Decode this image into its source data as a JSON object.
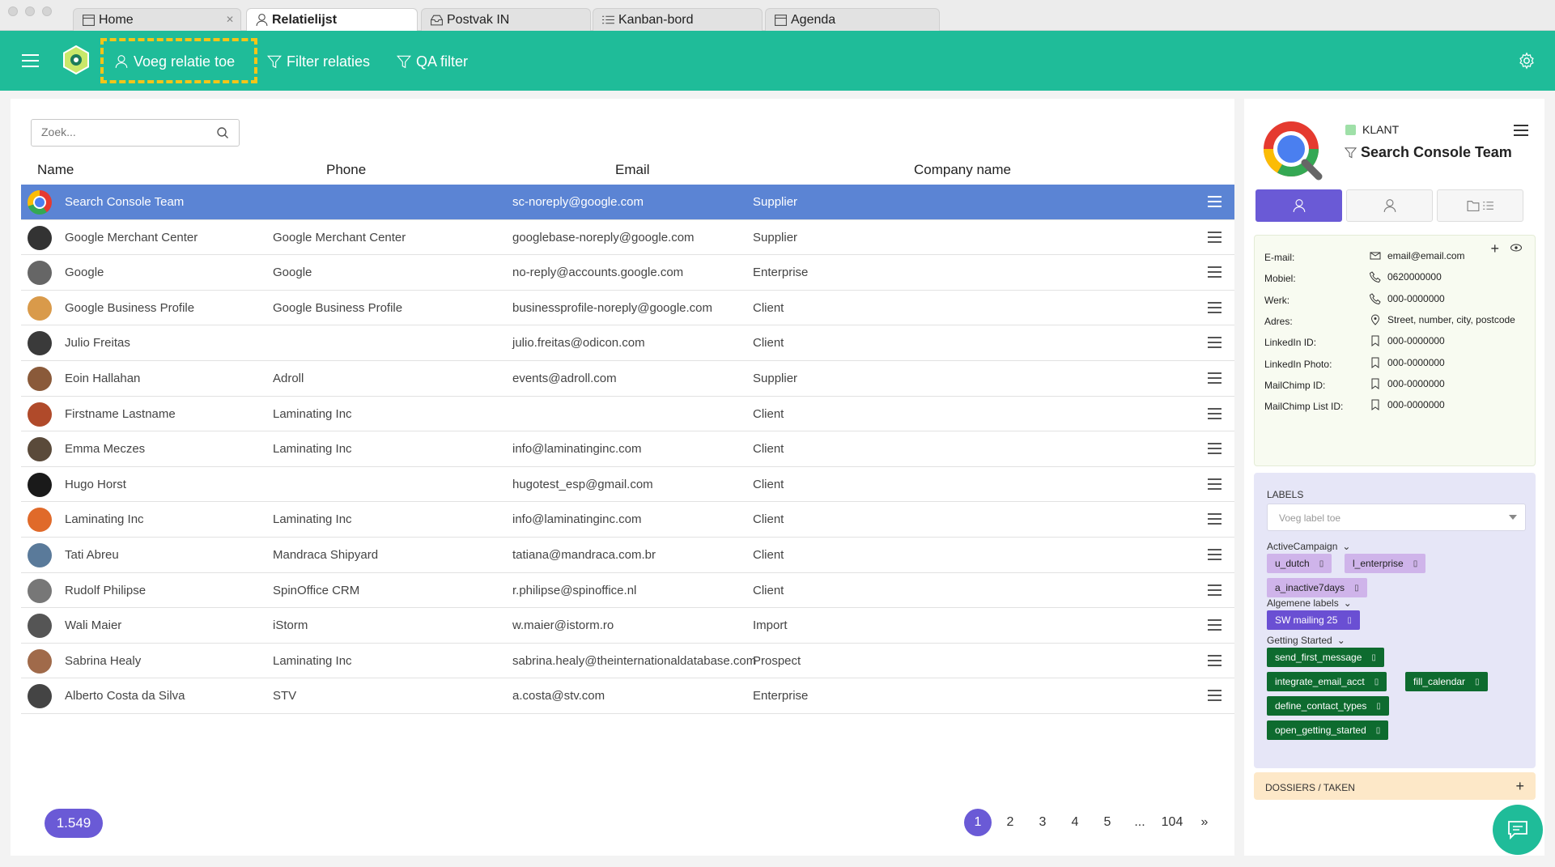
{
  "tabs": [
    {
      "label": "Home",
      "icon": "calendar-icon"
    },
    {
      "label": "Relatielijst",
      "icon": "user-icon"
    },
    {
      "label": "Postvak IN",
      "icon": "inbox-icon"
    },
    {
      "label": "Kanban-bord",
      "icon": "list-icon"
    },
    {
      "label": "Agenda",
      "icon": "calendar-icon"
    }
  ],
  "toolbar": {
    "add_relation": "Voeg relatie toe",
    "filter_relations": "Filter relaties",
    "qa_filter": "QA filter"
  },
  "search": {
    "placeholder": "Zoek..."
  },
  "table": {
    "headers": [
      "Name",
      "Phone",
      "Email",
      "Company name"
    ],
    "rows": [
      {
        "name": "Search Console Team",
        "phone": "",
        "email": "sc-noreply@google.com",
        "company": "Supplier"
      },
      {
        "name": "Google Merchant Center",
        "phone": "Google Merchant Center",
        "email": "googlebase-noreply@google.com",
        "company": "Supplier"
      },
      {
        "name": "Google",
        "phone": "Google",
        "email": "no-reply@accounts.google.com",
        "company": "Enterprise"
      },
      {
        "name": "Google Business Profile",
        "phone": "Google Business Profile",
        "email": "businessprofile-noreply@google.com",
        "company": "Client"
      },
      {
        "name": "Julio Freitas",
        "phone": "",
        "email": "julio.freitas@odicon.com",
        "company": "Client"
      },
      {
        "name": "Eoin Hallahan",
        "phone": "Adroll",
        "email": "events@adroll.com",
        "company": "Supplier"
      },
      {
        "name": "Firstname Lastname",
        "phone": "Laminating Inc",
        "email": "",
        "company": "Client"
      },
      {
        "name": "Emma Meczes",
        "phone": "Laminating Inc",
        "email": "info@laminatinginc.com",
        "company": "Client"
      },
      {
        "name": "Hugo Horst",
        "phone": "",
        "email": "hugotest_esp@gmail.com",
        "company": "Client"
      },
      {
        "name": "Laminating Inc",
        "phone": "Laminating Inc",
        "email": "info@laminatinginc.com",
        "company": "Client"
      },
      {
        "name": "Tati Abreu",
        "phone": "Mandraca Shipyard",
        "email": "tatiana@mandraca.com.br",
        "company": "Client"
      },
      {
        "name": "Rudolf Philipse",
        "phone": "SpinOffice CRM",
        "email": "r.philipse@spinoffice.nl",
        "company": "Client"
      },
      {
        "name": "Wali Maier",
        "phone": "iStorm",
        "email": "w.maier@istorm.ro",
        "company": "Import"
      },
      {
        "name": "Sabrina Healy",
        "phone": "Laminating Inc",
        "email": "sabrina.healy@theinternationaldatabase.com",
        "company": "Prospect"
      },
      {
        "name": "Alberto Costa da Silva",
        "phone": "STV",
        "email": "a.costa@stv.com",
        "company": "Enterprise"
      }
    ]
  },
  "count": "1.549",
  "pagination": [
    "1",
    "2",
    "3",
    "4",
    "5",
    "...",
    "104",
    "»"
  ],
  "side": {
    "type_label": "KLANT",
    "title": "Search Console Team",
    "fields": [
      {
        "label": "E-mail:",
        "value": "email@email.com",
        "icon": "mail-icon"
      },
      {
        "label": "Mobiel:",
        "value": "0620000000",
        "icon": "phone-icon"
      },
      {
        "label": "Werk:",
        "value": "000-0000000",
        "icon": "phone-icon"
      },
      {
        "label": "Adres:",
        "value": "Street, number, city, postcode",
        "icon": "pin-icon"
      },
      {
        "label": "LinkedIn ID:",
        "value": "000-0000000",
        "icon": "bookmark-icon"
      },
      {
        "label": "LinkedIn Photo:",
        "value": "000-0000000",
        "icon": "bookmark-icon"
      },
      {
        "label": "MailChimp ID:",
        "value": "000-0000000",
        "icon": "bookmark-icon"
      },
      {
        "label": "MailChimp List ID:",
        "value": "000-0000000",
        "icon": "bookmark-icon"
      }
    ],
    "labels_heading": "LABELS",
    "labels_placeholder": "Voeg label toe",
    "groups": {
      "active_campaign": "ActiveCampaign",
      "general": "Algemene labels",
      "getting_started": "Getting Started"
    },
    "chips": {
      "ac": [
        "u_dutch",
        "l_enterprise",
        "a_inactive7days"
      ],
      "general": [
        "SW mailing 25"
      ],
      "gs": [
        "send_first_message",
        "integrate_email_acct",
        "fill_calendar",
        "define_contact_types",
        "open_getting_started"
      ]
    },
    "dossiers": "DOSSIERS / TAKEN"
  },
  "colors": {
    "accent": "#1fbc99",
    "primary": "#6a5ad6",
    "selected_row": "#5b84d4"
  }
}
